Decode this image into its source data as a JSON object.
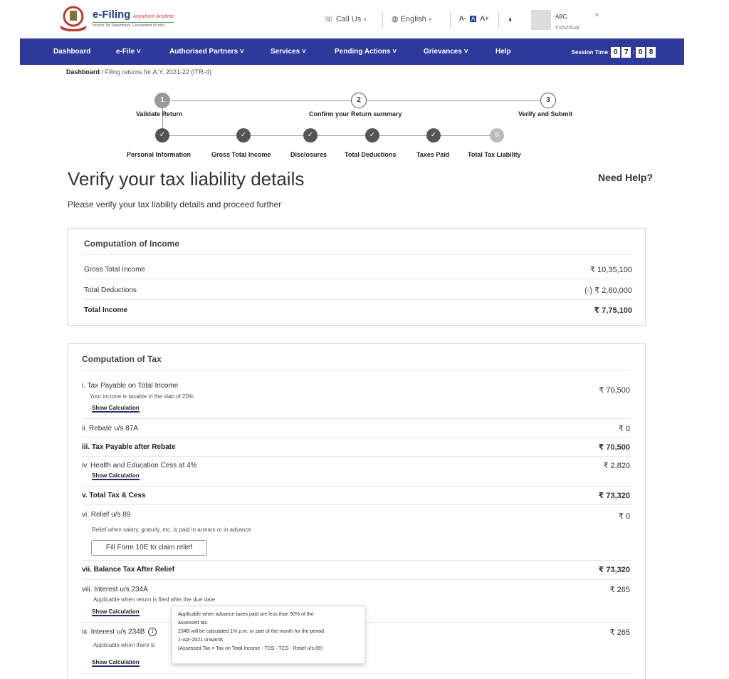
{
  "header": {
    "logo_title": "e-Filing",
    "logo_tagline": "Anywhere Anytime",
    "logo_subtitle": "Income Tax Department, Government of India",
    "call_us": "Call Us",
    "language": "English",
    "font_small": "A-",
    "font_normal": "A",
    "font_large": "A+",
    "user_name": "ABC",
    "user_role": "Individual"
  },
  "nav": {
    "items": [
      "Dashboard",
      "e-File",
      "Authorised Partners",
      "Services",
      "Pending Actions",
      "Grievances",
      "Help"
    ],
    "session_label": "Session Time",
    "session_digits": [
      "0",
      "7",
      "0",
      "8"
    ]
  },
  "breadcrumb": {
    "root": "Dashboard",
    "current": "Filing returns for A.Y. 2021-22 (ITR-4)"
  },
  "stepper": {
    "main": [
      {
        "num": "1",
        "title": "Validate Return",
        "state": "done"
      },
      {
        "num": "2",
        "title": "Confirm your Return summary",
        "state": "todo"
      },
      {
        "num": "3",
        "title": "Verify and Submit",
        "state": "todo"
      }
    ],
    "sub": [
      {
        "label": "Personal Information",
        "symbol": "✓",
        "state": "done"
      },
      {
        "label": "Gross Total Income",
        "symbol": "✓",
        "state": "done"
      },
      {
        "label": "Disclosures",
        "symbol": "✓",
        "state": "done"
      },
      {
        "label": "Total Deductions",
        "symbol": "✓",
        "state": "done"
      },
      {
        "label": "Taxes Paid",
        "symbol": "✓",
        "state": "done"
      },
      {
        "label": "Total Tax Liability",
        "symbol": "6",
        "state": "current"
      }
    ]
  },
  "page": {
    "title": "Verify your tax liability details",
    "need_help": "Need Help?",
    "subtitle": "Please verify your tax liability details and proceed further"
  },
  "income": {
    "title": "Computation of Income",
    "rows": [
      {
        "label": "Gross Total Income",
        "value": "₹ 10,35,100"
      },
      {
        "label": "Total Deductions",
        "value": "(-) ₹ 2,60,000"
      },
      {
        "label": "Total Income",
        "value": "₹ 7,75,100"
      }
    ]
  },
  "tax": {
    "title": "Computation of Tax",
    "show_calc_label": "Show Calculation",
    "r1_label": "i. Tax Payable on Total Income",
    "r1_note": "Your income is taxable in the slab of 20%",
    "r1_value": "₹ 70,500",
    "r2_label": "ii. Rebate u/s 87A",
    "r2_value": "₹ 0",
    "r3_label": "iii. Tax Payable after Rebate",
    "r3_value": "₹ 70,500",
    "r4_label": "iv. Health and Education Cess at 4%",
    "r4_value": "₹ 2,820",
    "r5_label": "v. Total Tax & Cess",
    "r5_value": "₹ 73,320",
    "r6_label": "vi. Relief u/s 89",
    "r6_note": "Relief when salary, gratuity, etc. is paid in arrears or in advance",
    "r6_value": "₹ 0",
    "r6_button": "Fill Form 10E to claim relief",
    "r7_label": "vii. Balance Tax After Relief",
    "r7_value": "₹ 73,320",
    "r8_label": "viii. Interest u/s 234A",
    "r8_note": "Applicable when return is filed after the due date",
    "r8_value": "₹ 265",
    "r9_label": "ix. Interest u/s 234B",
    "r9_note": "Applicable when there is",
    "r9_value": "₹ 265"
  },
  "tooltip": {
    "line1": "Applicable when advance taxes paid are less than 90% of the",
    "line2": "assessed tax.",
    "line3": "234B will be calculated 1%  p.m. or part of the month for the period",
    "line4": "1-Apr-2021 onwards",
    "line5": "(Assessed Tax = Tax on Total Income - TDS - TCS - Relief u/s 89)"
  },
  "colors": {
    "nav_bg": "#2d3a9c",
    "link_underline": "#1f2f7a"
  }
}
